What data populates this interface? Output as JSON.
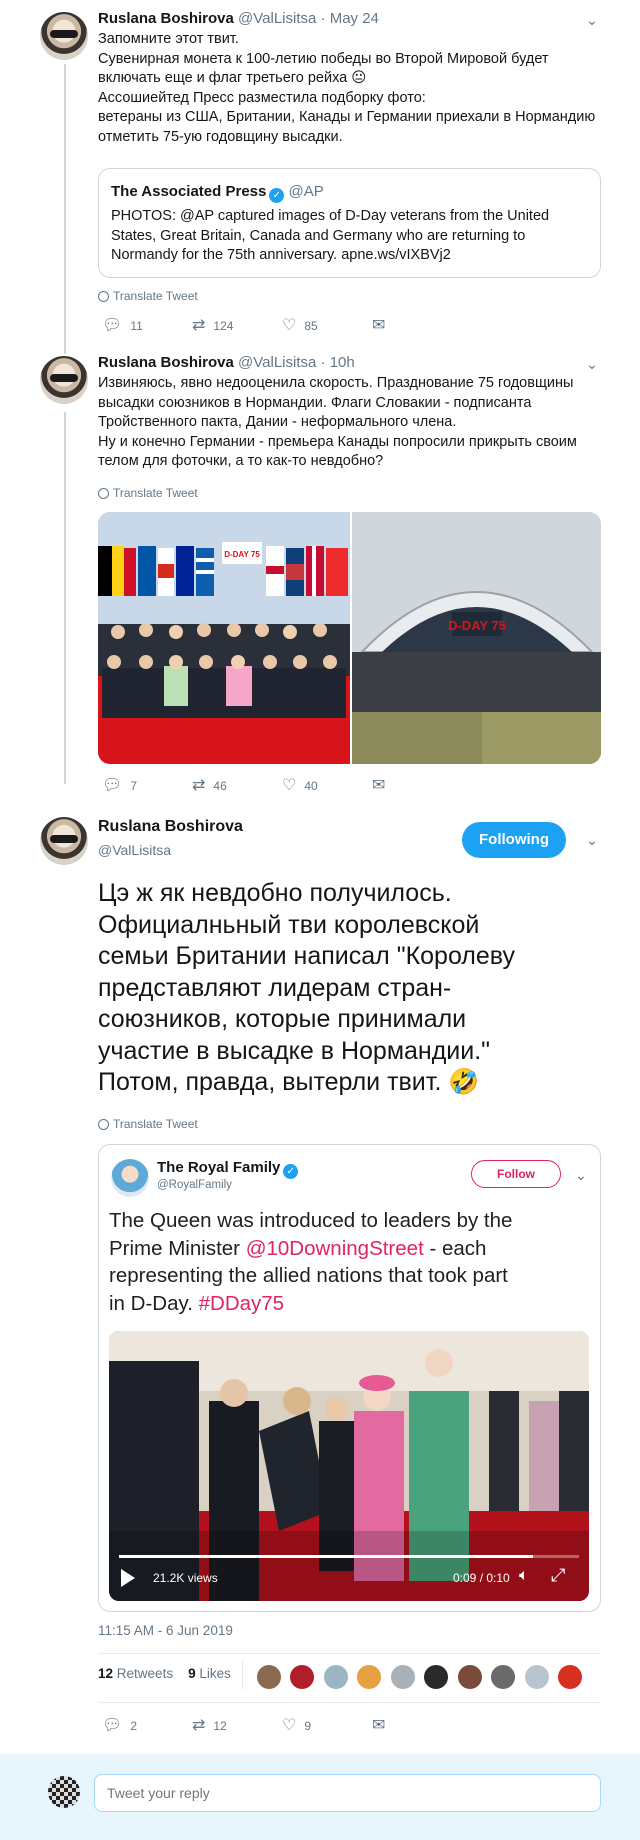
{
  "tweet1": {
    "name": "Ruslana Boshirova",
    "handle": "@ValLisitsa",
    "date": "· May 24",
    "lines": [
      "Запомните этот твит.",
      "Сувенирная монета к 100-летию победы во Второй Мировой будет",
      "включать еще и флаг третьего рейха 😐",
      "Ассошиейтед Пресс разместила подборку фото:",
      "ветераны из США, Британии, Канады и Германии приехали в Нормандию",
      "отметить 75-ую годовщину высадки."
    ],
    "quote": {
      "name": "The Associated Press",
      "handle": "@AP",
      "lines": [
        "PHOTOS: @AP captured images of D-Day veterans from the United",
        "States, Great Britain, Canada and Germany who are returning to",
        "Normandy for the 75th anniversary. apne.ws/vIXBVj2"
      ]
    },
    "translate": "Translate Tweet",
    "replies": "11",
    "retweets": "124",
    "likes": "85"
  },
  "tweet2": {
    "name": "Ruslana Boshirova",
    "handle": "@ValLisitsa",
    "date": "· 10h",
    "lines": [
      "Извиняюсь, явно недооценила скорость. Празднование 75 годовщины",
      "высадки союзников в Нормандии. Флаги Словакии - подписанта",
      "Тройственного пакта, Дании - неформального члена.",
      "Ну и конечно Германии - премьера Канады попросили прикрыть своим",
      "телом для фоточки, а то как-то невдобно?"
    ],
    "translate": "Translate Tweet",
    "photo_banner": "D-DAY 75",
    "stage_text": "D-DAY 75",
    "replies": "7",
    "retweets": "46",
    "likes": "40"
  },
  "tweet3": {
    "name": "Ruslana Boshirova",
    "handle": "@ValLisitsa",
    "follow_label": "Following",
    "lines": [
      "Цэ ж як невдобно получилось.",
      "Официалньный тви королевской",
      "семьи Британии написал \"Королеву",
      "представляют лидерам стран-",
      "союзников, которые принимали",
      "участие в высадке в Нормандии.\"",
      "Потом, правда, вытерли твит. 🤣"
    ],
    "translate": "Translate Tweet",
    "quote": {
      "name": "The Royal Family",
      "handle": "@RoyalFamily",
      "follow_label": "Follow",
      "text_plain_1": "The Queen was introduced to leaders by the",
      "text_plain_2": "Prime Minister ",
      "text_link_1": "@10DowningStreet",
      "text_plain_3": " - each",
      "text_plain_4": "representing the allied nations that took part",
      "text_plain_5": "in D-Day. ",
      "text_link_2": "#DDay75",
      "video_views": "21.2K views",
      "video_time": "0:09 / 0:10",
      "video_progress": 0.9
    },
    "timestamp": "11:15 AM - 6 Jun 2019",
    "retweets_count": "12",
    "retweets_label": "Retweets",
    "likes_count": "9",
    "likes_label": "Likes",
    "replies": "2",
    "retweets": "12",
    "likes": "9"
  },
  "reply": {
    "placeholder": "Tweet your reply"
  },
  "colors": {
    "accent": "#1da1f2",
    "link_red": "#e0245e",
    "muted": "#657786"
  }
}
